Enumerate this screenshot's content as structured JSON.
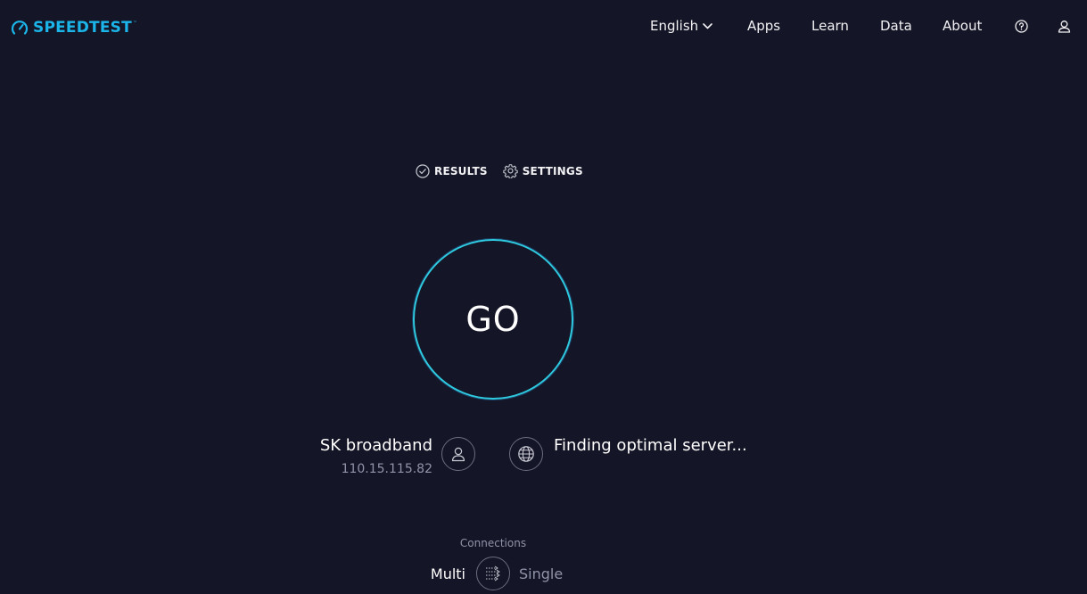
{
  "header": {
    "logo_text": "SPEEDTEST",
    "nav": {
      "language": "English",
      "apps": "Apps",
      "learn": "Learn",
      "data": "Data",
      "about": "About"
    },
    "icons": [
      "speedometer-icon",
      "chevron-down-icon",
      "help-icon",
      "user-icon"
    ]
  },
  "tabs": {
    "results": "RESULTS",
    "settings": "SETTINGS"
  },
  "go_button": {
    "label": "GO"
  },
  "isp": {
    "name": "SK broadband",
    "ip": "110.15.115.82"
  },
  "server": {
    "status": "Finding optimal server..."
  },
  "connections": {
    "label": "Connections",
    "multi": "Multi",
    "single": "Single",
    "selected": "Multi"
  },
  "colors": {
    "background": "#141526",
    "accent": "#1bb5e9",
    "go_ring": "#2ecbe0",
    "muted_text": "#9193a8"
  }
}
